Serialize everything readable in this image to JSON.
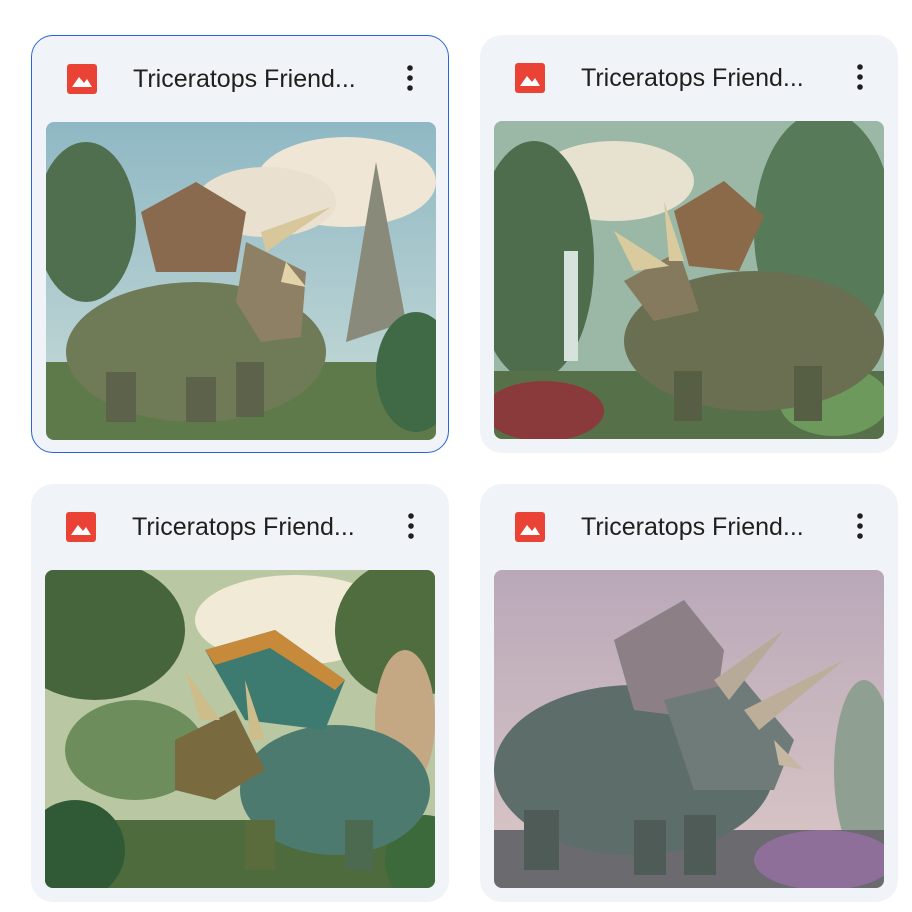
{
  "files": [
    {
      "title": "Triceratops Friend...",
      "type_icon": "image-file-icon",
      "selected": true,
      "menu_icon": "more-vert-icon"
    },
    {
      "title": "Triceratops Friend...",
      "type_icon": "image-file-icon",
      "selected": false,
      "menu_icon": "more-vert-icon"
    },
    {
      "title": "Triceratops Friend...",
      "type_icon": "image-file-icon",
      "selected": false,
      "menu_icon": "more-vert-icon"
    },
    {
      "title": "Triceratops Friend...",
      "type_icon": "image-file-icon",
      "selected": false,
      "menu_icon": "more-vert-icon"
    }
  ],
  "colors": {
    "card_bg": "#f0f4f9",
    "selected_border": "#2b63d9",
    "image_icon": "#ea4335",
    "title_text": "#1f1f1f"
  }
}
